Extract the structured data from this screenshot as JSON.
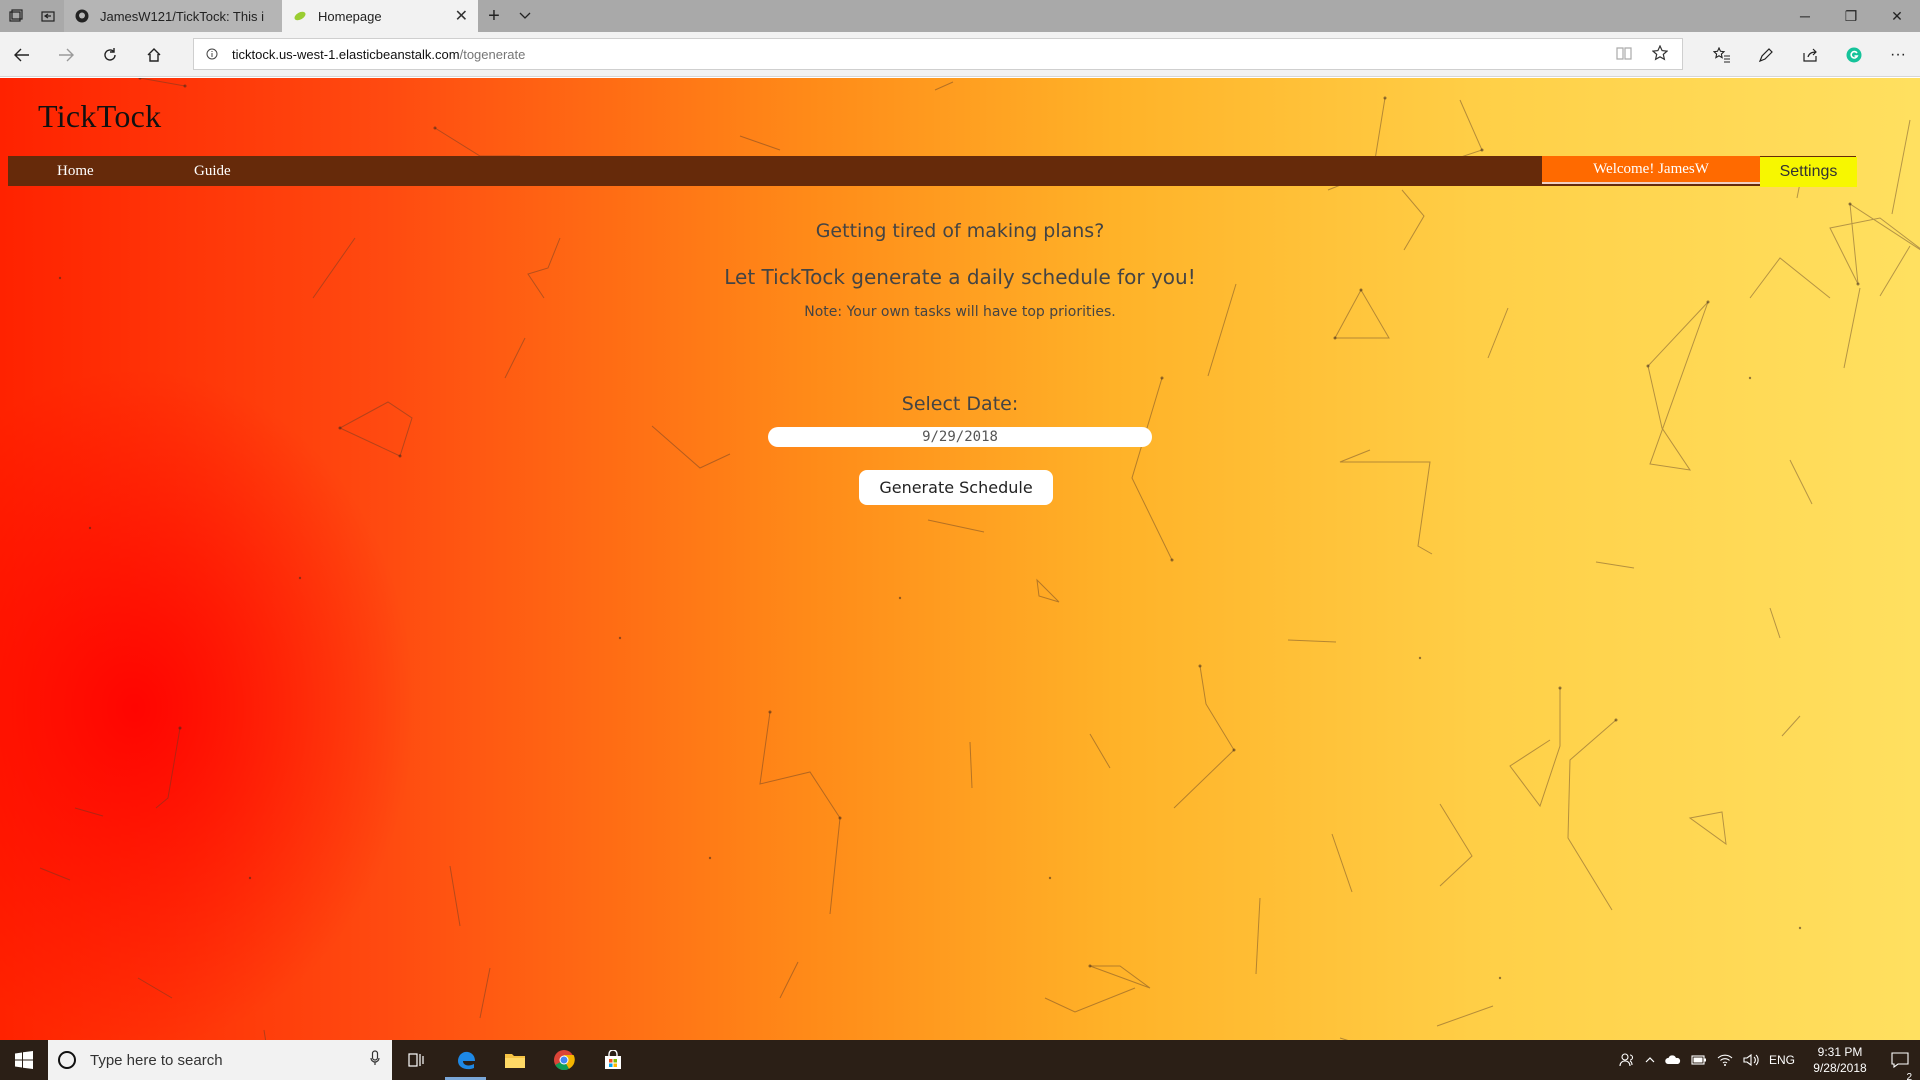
{
  "browser": {
    "tabs": [
      {
        "title": "JamesW121/TickTock: This i",
        "favicon": "github-icon",
        "active": false
      },
      {
        "title": "Homepage",
        "favicon": "leaf-icon",
        "active": true
      }
    ],
    "url_host": "ticktock.us-west-1.elasticbeanstalk.com",
    "url_path": "/togenerate"
  },
  "site": {
    "logo": "TickTock",
    "nav": {
      "home": "Home",
      "guide": "Guide",
      "welcome": "Welcome! JamesW",
      "settings": "Settings"
    },
    "headline1": "Getting tired of making plans?",
    "headline2": "Let TickTock generate a daily schedule for you!",
    "note": "Note: Your own tasks will have top priorities.",
    "date_label": "Select Date:",
    "date_value": "9/29/2018",
    "generate_button": "Generate Schedule"
  },
  "taskbar": {
    "search_placeholder": "Type here to search",
    "apps": [
      "task-view-icon",
      "edge-icon",
      "file-explorer-icon",
      "chrome-icon",
      "store-icon"
    ],
    "language": "ENG",
    "time": "9:31 PM",
    "date": "9/28/2018",
    "notification_count": "2"
  },
  "colors": {
    "navbar": "#662a0a",
    "welcome": "#ff6a00",
    "settings": "#f7f700",
    "gradient_left": "#ff2200",
    "gradient_right": "#ffe060"
  }
}
